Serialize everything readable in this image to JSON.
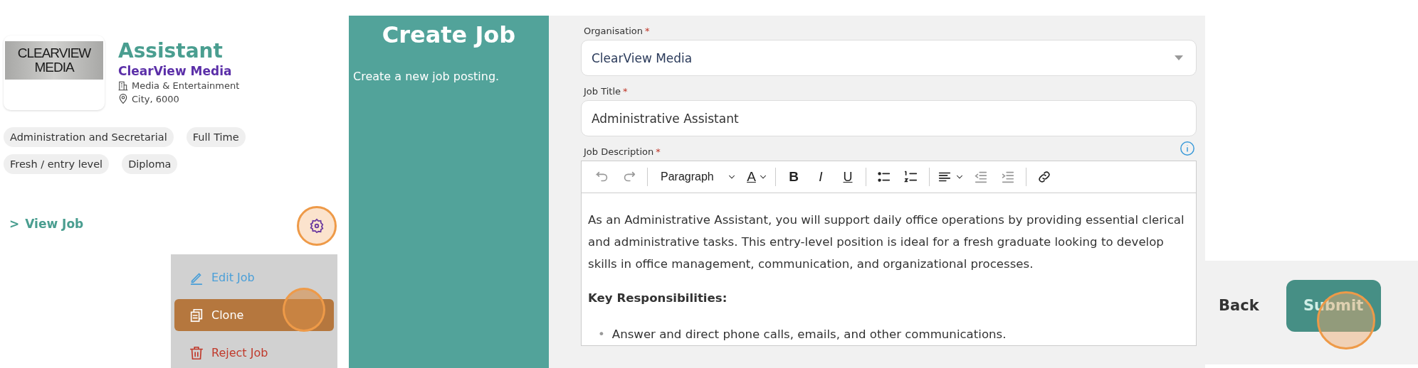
{
  "job_card": {
    "logo_lines": [
      "CLEARVIEW",
      "MEDIA"
    ],
    "title": "Assistant",
    "company": "ClearView Media",
    "industry": "Media & Entertainment",
    "location": "City, 6000",
    "tags": [
      "Administration and Secretarial",
      "Full Time",
      "Fresh / entry level",
      "Diploma"
    ],
    "view_link": {
      "chevron": ">",
      "label": "View Job"
    }
  },
  "actions_menu": {
    "items": [
      {
        "label": "Edit Job",
        "kind": "edit",
        "selected": false
      },
      {
        "label": "Clone",
        "kind": "clone",
        "selected": true
      },
      {
        "label": "Reject Job",
        "kind": "reject",
        "selected": false
      }
    ]
  },
  "intro": {
    "title": "Create Job",
    "subtitle": "Create a new job posting."
  },
  "form": {
    "fields": [
      {
        "label": "Organisation",
        "marker": "*",
        "kind": "select",
        "value": "ClearView Media"
      },
      {
        "label": "Job Title",
        "marker": "*",
        "kind": "text",
        "value": "Administrative Assistant"
      }
    ],
    "description": {
      "label": "Job Description",
      "marker": "*",
      "toolbar": [
        {
          "kind": "undo",
          "disabled": true
        },
        {
          "kind": "redo",
          "disabled": true
        },
        {
          "kind": "sep"
        },
        {
          "kind": "format",
          "label": "Paragraph",
          "disabled": false
        },
        {
          "kind": "color",
          "label": "A",
          "disabled": false
        },
        {
          "kind": "sep"
        },
        {
          "kind": "bold",
          "label": "B",
          "disabled": false
        },
        {
          "kind": "italic",
          "label": "I",
          "disabled": false
        },
        {
          "kind": "underline",
          "label": "U",
          "disabled": false
        },
        {
          "kind": "sep"
        },
        {
          "kind": "bullets",
          "disabled": false
        },
        {
          "kind": "numbers",
          "disabled": false
        },
        {
          "kind": "sep"
        },
        {
          "kind": "align",
          "disabled": false
        },
        {
          "kind": "outdent",
          "disabled": true
        },
        {
          "kind": "indent",
          "disabled": true
        },
        {
          "kind": "sep"
        },
        {
          "kind": "link",
          "disabled": false
        }
      ],
      "paragraph": "As an Administrative Assistant, you will support daily office operations by providing essential clerical and administrative tasks. This entry-level position is ideal for a fresh graduate looking to develop skills in office management, communication, and organizational processes.",
      "heading": "Key Responsibilities:",
      "bullets": [
        {
          "marker": "•",
          "text": "Answer and direct phone calls, emails, and other communications."
        }
      ]
    }
  },
  "footer": {
    "buttons": [
      {
        "label": "Back",
        "kind": "text"
      },
      {
        "label": "Submit",
        "kind": "primary"
      }
    ]
  }
}
